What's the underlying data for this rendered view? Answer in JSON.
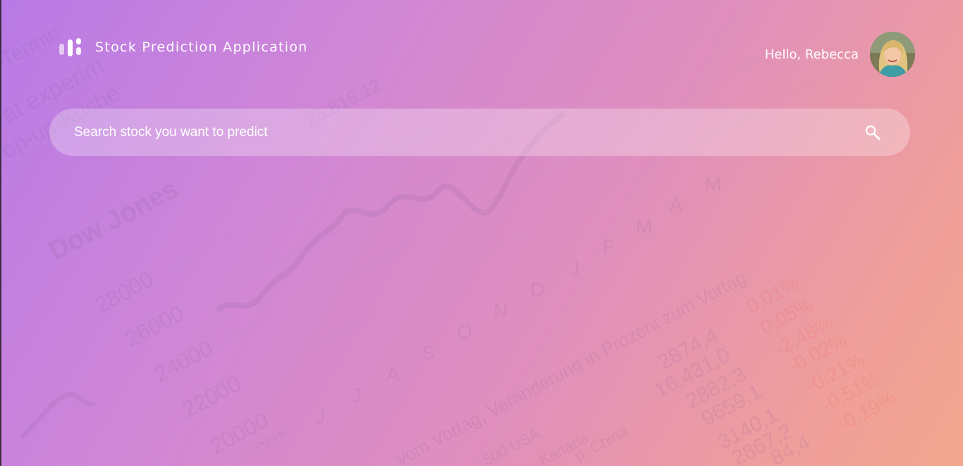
{
  "header": {
    "app_title": "Stock Prediction Application",
    "logo_icon": "bars-logo-icon"
  },
  "user": {
    "greeting": "Hello, Rebecca",
    "avatar": "user-avatar"
  },
  "search": {
    "placeholder": "Search stock you want to predict",
    "value": "",
    "icon": "search-icon"
  },
  "background": {
    "label": "Dow Jones",
    "levels": [
      "28000",
      "26000",
      "24000",
      "22000",
      "20000"
    ],
    "unit": "Punkte",
    "months": [
      "J",
      "J",
      "A",
      "S",
      "O",
      "N",
      "D",
      "J",
      "F",
      "M",
      "A",
      "M"
    ],
    "headline": "vom Vortag, Veränderung in Prozent zum Vortag",
    "values": [
      "2874,4",
      "16.431,0",
      "2882,3",
      "9659,1",
      "3140,1",
      "2867,2",
      "84,4"
    ],
    "changes": [
      "0,01%",
      "0,05%",
      "-2,48%",
      "-0,02%",
      "-0,21%",
      "-0,51%",
      "-0,19%"
    ],
    "regions": [
      "500 USA",
      "Kanada",
      "p. China"
    ],
    "top_fragments": [
      "Termin",
      "at experim",
      "op-up-Küche",
      "25.816,12"
    ],
    "colors": {
      "gradient_start": "#b87ae6",
      "gradient_mid": "#e08fbd",
      "gradient_end": "#f3a78e"
    }
  }
}
